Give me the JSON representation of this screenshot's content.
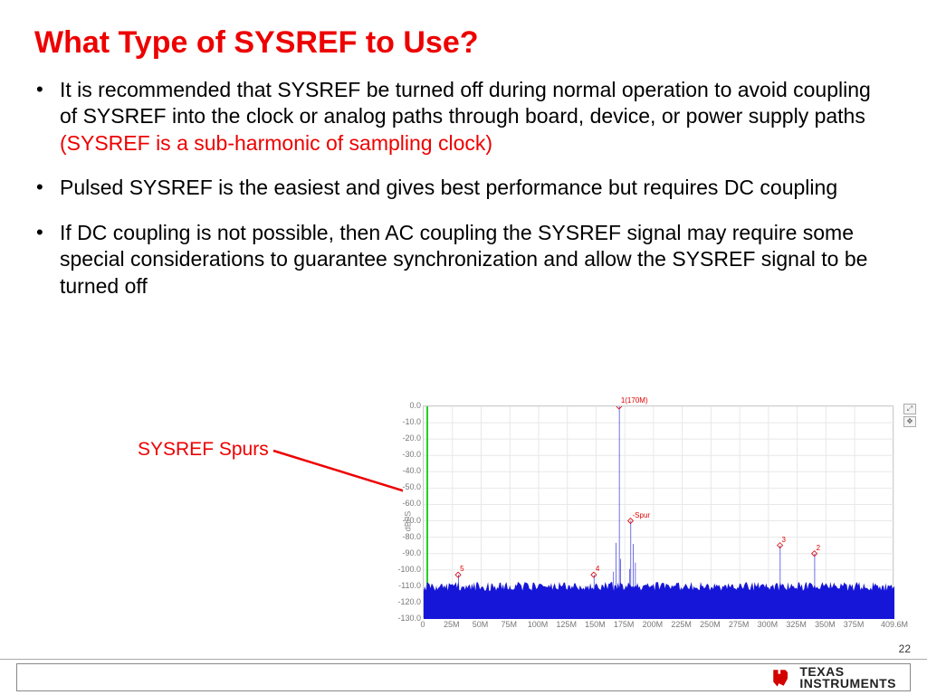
{
  "title": "What Type of SYSREF to Use?",
  "bullets": [
    {
      "pre": "It is recommended that SYSREF be turned off during normal operation to avoid coupling of SYSREF into the clock or analog paths through board, device, or power supply paths ",
      "em": "(SYSREF is a sub-harmonic of sampling clock)"
    },
    {
      "pre": "Pulsed SYSREF is the easiest and gives best performance but requires DC coupling",
      "em": ""
    },
    {
      "pre": "If DC coupling is not possible, then AC coupling the SYSREF signal may require some special considerations to guarantee synchronization and allow the SYSREF signal to be turned off",
      "em": ""
    }
  ],
  "annotation": "SYSREF Spurs",
  "page_number": "22",
  "footer_brand": {
    "l1": "TEXAS",
    "l2": "INSTRUMENTS"
  },
  "chart_data": {
    "type": "line",
    "title": "",
    "xlabel": "",
    "ylabel": "dBFS",
    "xlim": [
      0,
      409.6
    ],
    "ylim": [
      -130,
      0
    ],
    "x_ticks": [
      "0",
      "25M",
      "50M",
      "75M",
      "100M",
      "125M",
      "150M",
      "175M",
      "200M",
      "225M",
      "250M",
      "275M",
      "300M",
      "325M",
      "350M",
      "375M",
      "409.6M"
    ],
    "y_ticks": [
      "0.0",
      "-10.0",
      "-20.0",
      "-30.0",
      "-40.0",
      "-50.0",
      "-60.0",
      "-70.0",
      "-80.0",
      "-90.0",
      "-100.0",
      "-110.0",
      "-120.0",
      "-130.0"
    ],
    "noise_floor_db": -110,
    "markers": [
      {
        "id": "1",
        "label": "1(170M)",
        "x_mhz": 170,
        "db": 0
      },
      {
        "id": "Spur",
        "label": "-Spur",
        "x_mhz": 180,
        "db": -70
      },
      {
        "id": "3",
        "label": "3",
        "x_mhz": 310,
        "db": -85
      },
      {
        "id": "2",
        "label": "2",
        "x_mhz": 340,
        "db": -90
      },
      {
        "id": "5",
        "label": "5",
        "x_mhz": 30,
        "db": -103
      },
      {
        "id": "4",
        "label": "4",
        "x_mhz": 148,
        "db": -103
      }
    ]
  }
}
